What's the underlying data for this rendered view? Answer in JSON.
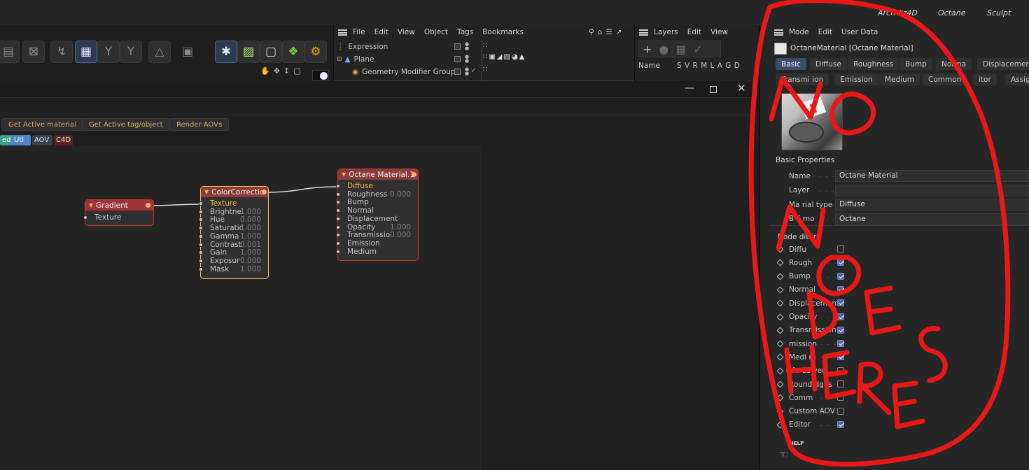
{
  "top": {
    "tabs": [
      "ArchViz4D",
      "Octane",
      "Sculpt"
    ]
  },
  "object_manager": {
    "menu": [
      "File",
      "Edit",
      "View",
      "Object",
      "Tags",
      "Bookmarks"
    ],
    "rows": [
      {
        "label": "Expression"
      },
      {
        "label": "Plane"
      },
      {
        "label": "Geometry Modifier Group"
      }
    ]
  },
  "layer_manager": {
    "menu": [
      "Layers",
      "Edit",
      "View"
    ],
    "header_name": "Name",
    "header_cols": "S V R M L A G D"
  },
  "node_editor": {
    "buttons": [
      "Get Active material",
      "Get Active tag/object",
      "Render AOVs"
    ],
    "category_tabs": [
      {
        "label": "ed",
        "color": "#3e9a8c"
      },
      {
        "label": "Utl",
        "color": "#4f86c8"
      },
      {
        "label": "AOV",
        "color": "#3a3f4c"
      },
      {
        "label": "C4D",
        "color": "#5a2222"
      }
    ],
    "nodes": {
      "gradient": {
        "title": "Gradient",
        "pins": [
          "Texture"
        ]
      },
      "colorcorrection": {
        "title": "ColorCorrectio",
        "pins": [
          {
            "name": "Texture",
            "value": ""
          },
          {
            "name": "Brightne",
            "value": "1.000"
          },
          {
            "name": "Hue",
            "value": "0.000"
          },
          {
            "name": "Saturatic",
            "value": "1.000"
          },
          {
            "name": "Gamma",
            "value": "1.000"
          },
          {
            "name": "Contrast",
            "value": "0.001"
          },
          {
            "name": "Gain",
            "value": "1.000"
          },
          {
            "name": "Exposur",
            "value": "0.000"
          },
          {
            "name": "Mask",
            "value": "1.000"
          }
        ]
      },
      "material": {
        "title": "Octane Material.1",
        "pins": [
          {
            "name": "Diffuse",
            "value": ""
          },
          {
            "name": "Roughness",
            "value": "0.000"
          },
          {
            "name": "Bump",
            "value": ""
          },
          {
            "name": "Normal",
            "value": ""
          },
          {
            "name": "Displacement",
            "value": ""
          },
          {
            "name": "Opacity",
            "value": "1.000"
          },
          {
            "name": "Transmissio",
            "value": "0.000"
          },
          {
            "name": "Emission",
            "value": ""
          },
          {
            "name": "Medium",
            "value": ""
          }
        ]
      }
    }
  },
  "attributes": {
    "menu": [
      "Mode",
      "Edit",
      "User Data"
    ],
    "title": "OctaneMaterial [Octane Material]",
    "tabs_row1": [
      "Basic",
      "Diffuse",
      "Roughness",
      "Bump",
      "Norma",
      "Displacement"
    ],
    "tabs_row2": [
      "Transmi ion",
      "Emission",
      "Medium",
      "Common",
      "itor",
      "Assig"
    ],
    "section": "Basic Properties",
    "fields": [
      {
        "label": "Name",
        "value": "Octane Material"
      },
      {
        "label": "Layer",
        "value": ""
      },
      {
        "label": "Ma rial type",
        "value": "Diffuse"
      },
      {
        "label": "B F mo",
        "value": "Octane"
      }
    ],
    "node_editor_label": "Node ditor",
    "channels": [
      {
        "label": "Diffu",
        "checked": false
      },
      {
        "label": "Rough",
        "checked": true
      },
      {
        "label": "Bump",
        "checked": true
      },
      {
        "label": "Normal",
        "checked": true
      },
      {
        "label": "Displacement",
        "checked": true
      },
      {
        "label": "Opacity",
        "checked": true
      },
      {
        "label": "Transmission",
        "checked": true
      },
      {
        "label": "mission",
        "checked": true
      },
      {
        "label": "Medi m",
        "checked": true
      },
      {
        "label": "Ma  La yer",
        "checked": false
      },
      {
        "label": "Round  dges",
        "checked": false
      },
      {
        "label": "Comm",
        "checked": false
      },
      {
        "label": "Custom AOV",
        "checked": false
      },
      {
        "label": "Editor",
        "checked": true
      }
    ],
    "help": "HELP"
  },
  "annotation": {
    "text": [
      "NO",
      "NODES",
      "HERE"
    ],
    "color": "#e81818"
  }
}
